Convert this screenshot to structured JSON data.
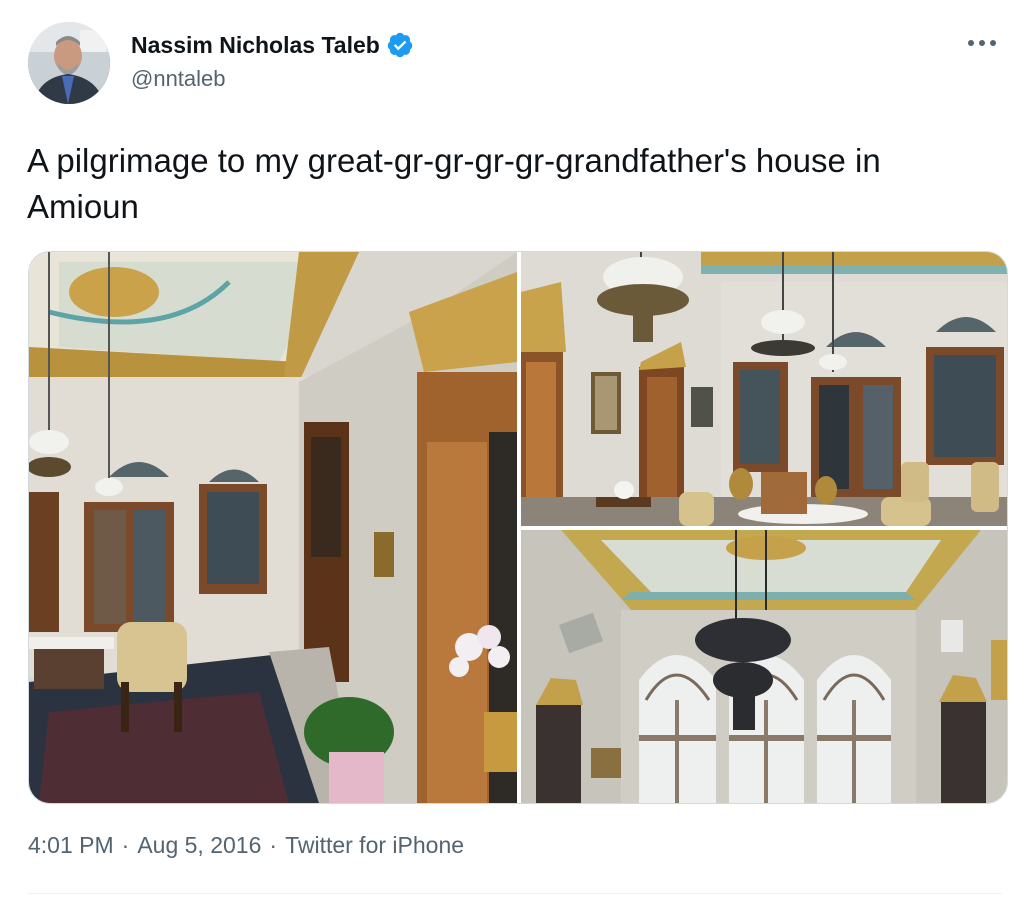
{
  "author": {
    "name": "Nassim Nicholas Taleb",
    "handle": "@nntaleb",
    "verified": true,
    "verified_color": "#1d9bf0"
  },
  "tweet": {
    "text": "A pilgrimage to my great-gr-gr-gr-gr-grandfather's house in Amioun"
  },
  "media": {
    "photos": [
      {
        "description": "living room with painted ceiling and carved doors"
      },
      {
        "description": "hall with hanging lamps and arched windows"
      },
      {
        "description": "ceiling with chandelier and arched windows"
      }
    ]
  },
  "meta": {
    "time": "4:01 PM",
    "date": "Aug 5, 2016",
    "source": "Twitter for iPhone",
    "separator": "·"
  },
  "icons": {
    "more": "more-icon",
    "verified": "verified-icon"
  },
  "colors": {
    "text_primary": "#0f1419",
    "text_secondary": "#536471",
    "border": "#cfd9de"
  }
}
